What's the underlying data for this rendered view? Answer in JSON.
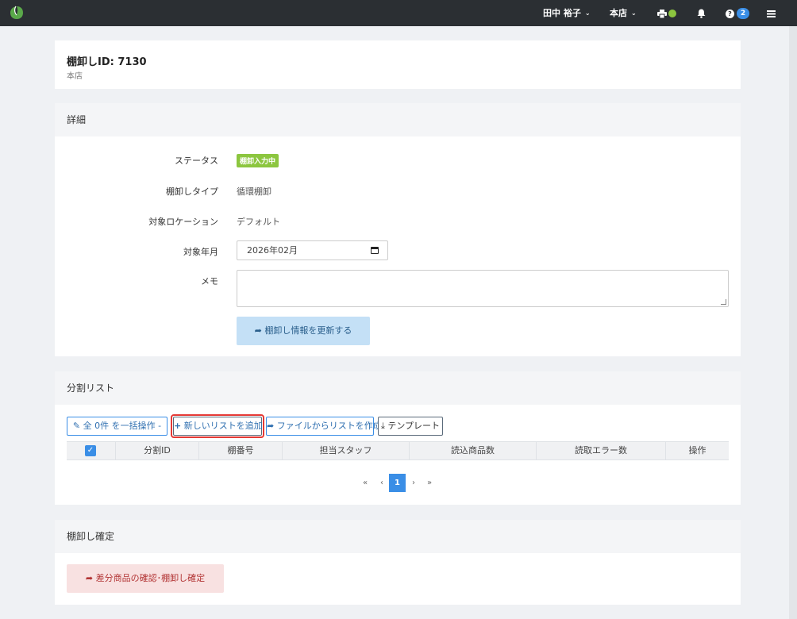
{
  "nav": {
    "user": "田中 裕子",
    "store": "本店",
    "help_badge": "2"
  },
  "title_panel": {
    "title": "棚卸しID: 7130",
    "subtitle": "本店"
  },
  "detail": {
    "heading": "詳細",
    "status_label": "ステータス",
    "status_value": "棚卸入力中",
    "type_label": "棚卸しタイプ",
    "type_value": "循環棚卸",
    "location_label": "対象ロケーション",
    "location_value": "デフォルト",
    "month_label": "対象年月",
    "month_value": "2026年02月",
    "memo_label": "メモ",
    "memo_value": "",
    "update_button": "棚卸し情報を更新する"
  },
  "split_list": {
    "heading": "分割リスト",
    "bulk_button": "全 0件 を一括操作 -",
    "add_button": "新しいリストを追加",
    "from_file_button": "ファイルからリストを作成",
    "template_button": "テンプレート",
    "columns": [
      "分割ID",
      "棚番号",
      "担当スタッフ",
      "読込商品数",
      "読取エラー数",
      "操作"
    ],
    "pager": [
      "«",
      "‹",
      "1",
      "›",
      "»"
    ]
  },
  "confirm": {
    "heading": "棚卸し確定",
    "button": "差分商品の確認･棚卸し確定"
  },
  "colors": {
    "topbar": "#2b2f33",
    "accent": "#3a8ee6",
    "status_green": "#8cc63f",
    "danger_bg": "#f8e1e1",
    "danger_text": "#b23434",
    "highlight_ring": "#e53935"
  }
}
